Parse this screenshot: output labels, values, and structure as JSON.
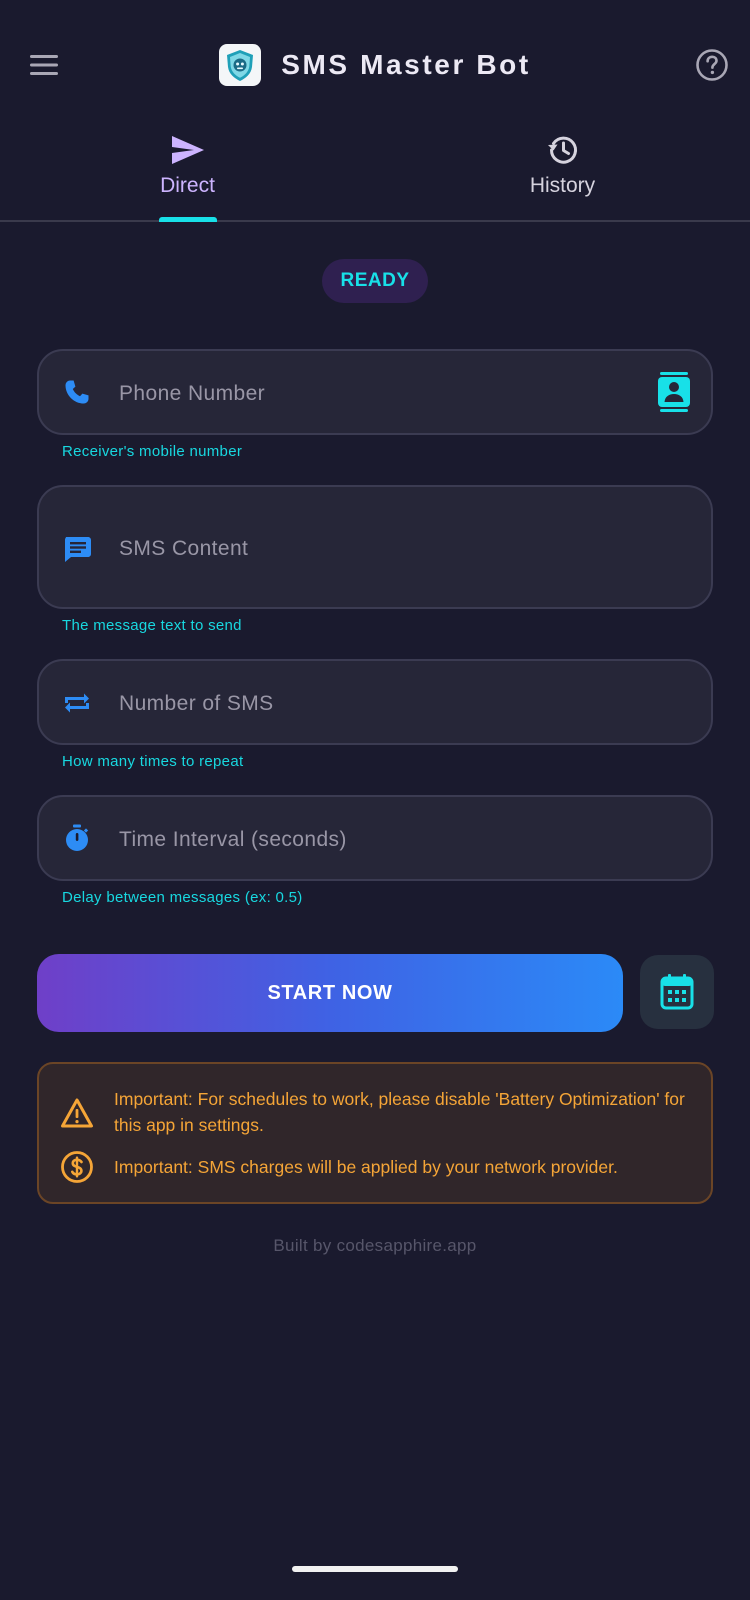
{
  "app": {
    "title": "SMS Master Bot"
  },
  "icons": {
    "menu": "hamburger-icon",
    "help": "help-circle-icon",
    "logo": "shield-bot-logo"
  },
  "tabs": [
    {
      "label": "Direct",
      "icon": "send-icon",
      "active": true
    },
    {
      "label": "History",
      "icon": "history-icon",
      "active": false
    }
  ],
  "status": {
    "label": "READY"
  },
  "fields": {
    "phone": {
      "placeholder": "Phone Number",
      "helper": "Receiver's mobile number",
      "icon": "phone-icon",
      "trailing_icon": "contact-book-icon"
    },
    "content": {
      "placeholder": "SMS Content",
      "helper": "The message text to send",
      "icon": "message-icon"
    },
    "count": {
      "placeholder": "Number of SMS",
      "helper": "How many times to repeat",
      "icon": "repeat-icon"
    },
    "interval": {
      "placeholder": "Time Interval (seconds)",
      "helper": "Delay between messages (ex: 0.5)",
      "icon": "timer-icon"
    }
  },
  "actions": {
    "start_label": "START NOW",
    "schedule_icon": "calendar-icon"
  },
  "notices": [
    {
      "icon": "warning-icon",
      "text": "Important: For schedules to work, please disable 'Battery Optimization' for this app in settings."
    },
    {
      "icon": "dollar-icon",
      "text": "Important: SMS charges will be applied by your network provider."
    }
  ],
  "footer": {
    "text": "Built by codesapphire.app"
  },
  "colors": {
    "background": "#1a1a2e",
    "accent_cyan": "#18e0e8",
    "accent_purple": "#cdb4ff",
    "field_bg": "#262638",
    "icon_blue": "#2d8cf5",
    "warning_orange": "#f5a537"
  }
}
